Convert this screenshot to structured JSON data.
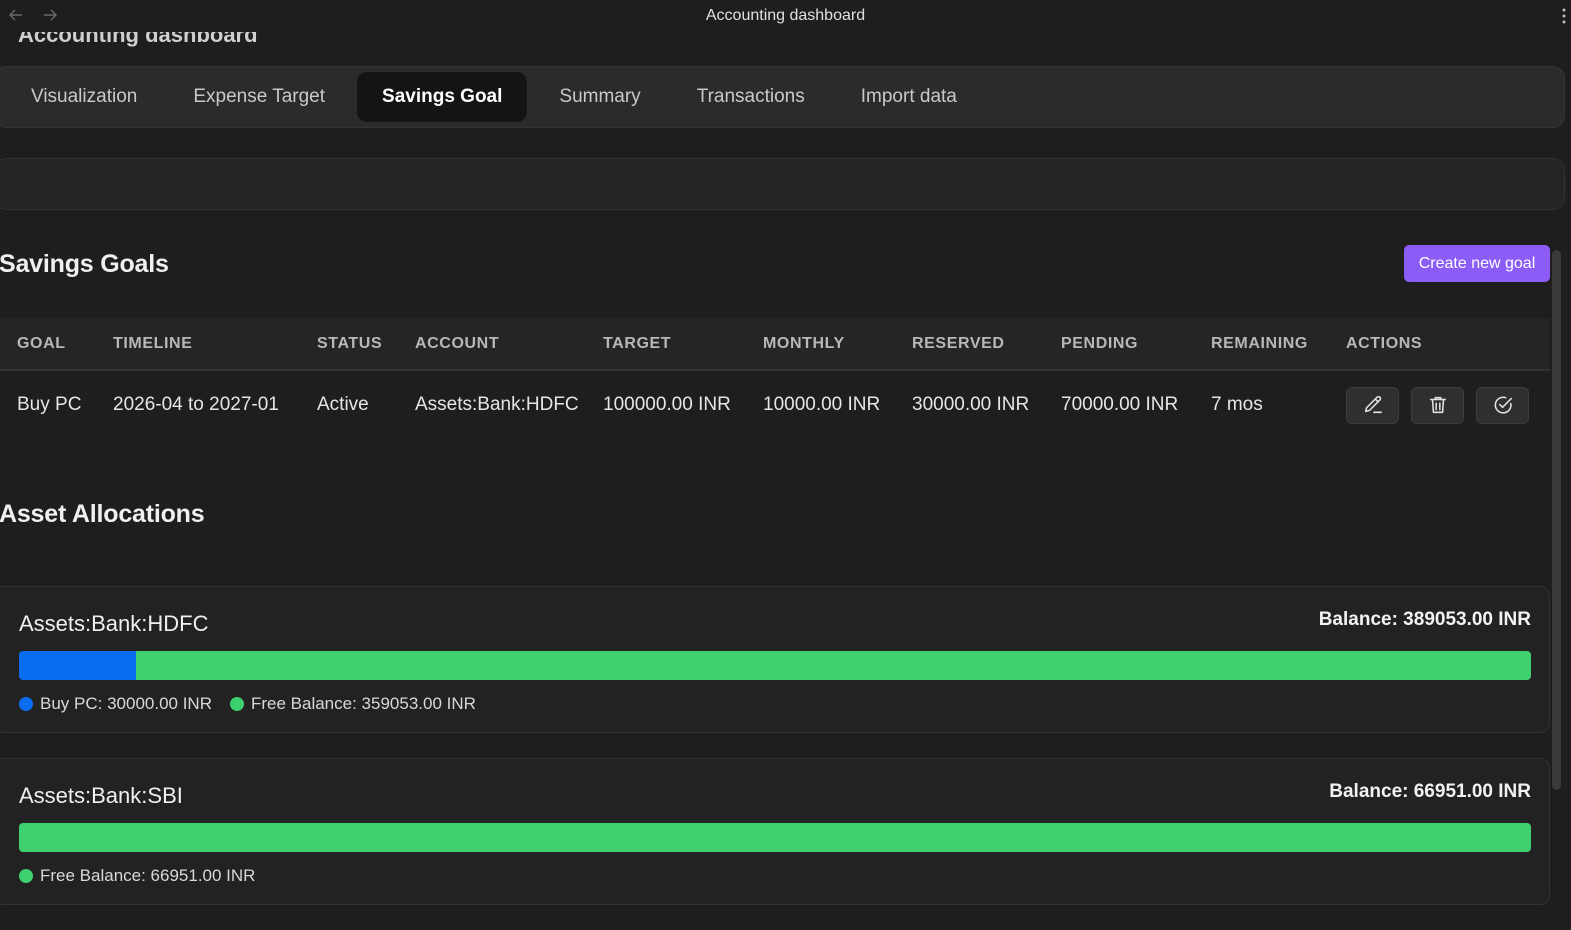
{
  "window": {
    "title": "Accounting dashboard",
    "page_heading": "Accounting dashboard"
  },
  "tabs": [
    {
      "label": "Visualization",
      "active": false
    },
    {
      "label": "Expense Target",
      "active": false
    },
    {
      "label": "Savings Goal",
      "active": true
    },
    {
      "label": "Summary",
      "active": false
    },
    {
      "label": "Transactions",
      "active": false
    },
    {
      "label": "Import data",
      "active": false
    }
  ],
  "savings_goals": {
    "title": "Savings Goals",
    "create_button": "Create new goal",
    "columns": [
      "GOAL",
      "TIMELINE",
      "STATUS",
      "ACCOUNT",
      "TARGET",
      "MONTHLY",
      "RESERVED",
      "PENDING",
      "REMAINING",
      "ACTIONS"
    ],
    "rows": [
      {
        "goal": "Buy PC",
        "timeline": "2026-04 to 2027-01",
        "status": "Active",
        "account": "Assets:Bank:HDFC",
        "target": "100000.00 INR",
        "monthly": "10000.00 INR",
        "reserved": "30000.00 INR",
        "pending": "70000.00 INR",
        "remaining": "7 mos",
        "actions": [
          "pencil-icon",
          "trash-icon",
          "check-circle-icon"
        ]
      }
    ]
  },
  "asset_allocations": {
    "title": "Asset Allocations",
    "accounts": [
      {
        "name": "Assets:Bank:HDFC",
        "balance": "Balance: 389053.00 INR",
        "segments": [
          {
            "label": "Buy PC: 30000.00 INR",
            "value": 30000,
            "color": "#0a6cf0"
          },
          {
            "label": "Free Balance: 359053.00 INR",
            "value": 359053,
            "color": "#3ecf6e"
          }
        ]
      },
      {
        "name": "Assets:Bank:SBI",
        "balance": "Balance: 66951.00 INR",
        "segments": [
          {
            "label": "Free Balance: 66951.00 INR",
            "value": 66951,
            "color": "#3ecf6e"
          }
        ]
      }
    ]
  },
  "colors": {
    "accent": "#8b5cf6",
    "reserved": "#0a6cf0",
    "free": "#3ecf6e"
  }
}
